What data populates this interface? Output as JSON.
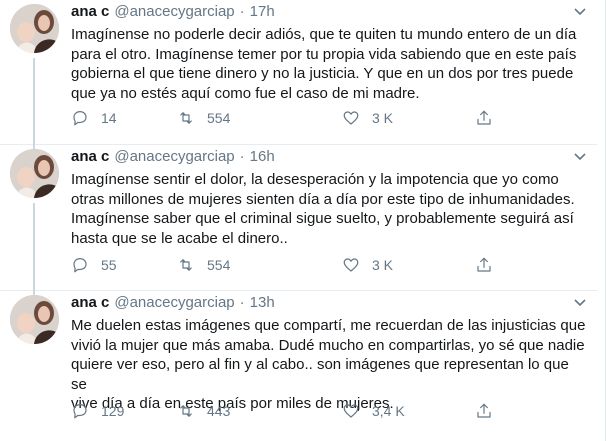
{
  "tweets": [
    {
      "name": "ana c",
      "handle": "@anacecygarciap",
      "separator": "·",
      "time": "17h",
      "text": "Imagínense no poderle decir adiós, que te quiten tu mundo entero de un día\npara el otro. Imagínense temer por tu propia vida sabiendo que en este país\ngobierna el que tiene dinero y no la justicia. Y que en un dos por tres puede\nque ya no estés aquí como fue el caso de mi madre.",
      "replies": "14",
      "retweets": "554",
      "likes": "3 K"
    },
    {
      "name": "ana c",
      "handle": "@anacecygarciap",
      "separator": "·",
      "time": "16h",
      "text": "Imagínense sentir el dolor, la desesperación y la impotencia que yo como\notras millones de mujeres sienten día a día por este tipo de inhumanidades.\nImagínense saber que el criminal sigue suelto, y probablemente seguirá así\nhasta que se le acabe el dinero..",
      "replies": "55",
      "retweets": "554",
      "likes": "3 K"
    },
    {
      "name": "ana c",
      "handle": "@anacecygarciap",
      "separator": "·",
      "time": "13h",
      "text": "Me duelen estas imágenes que compartí, me recuerdan de las injusticias que\nvivió la mujer que más amaba. Dudé mucho en compartirlas, yo sé que nadie\nquiere ver eso, pero al fin y al cabo.. son imágenes que representan lo que se\nvive día a día en este país por miles de mujeres.",
      "replies": "129",
      "retweets": "443",
      "likes": "3,4 K"
    }
  ],
  "icons": {
    "reply": "reply-icon",
    "retweet": "retweet-icon",
    "like": "heart-icon",
    "share": "share-icon",
    "more": "chevron-down-icon"
  },
  "colors": {
    "text": "#14171a",
    "secondary": "#657786",
    "border": "#e6ecf0",
    "thread_line": "#ccd6dd"
  }
}
